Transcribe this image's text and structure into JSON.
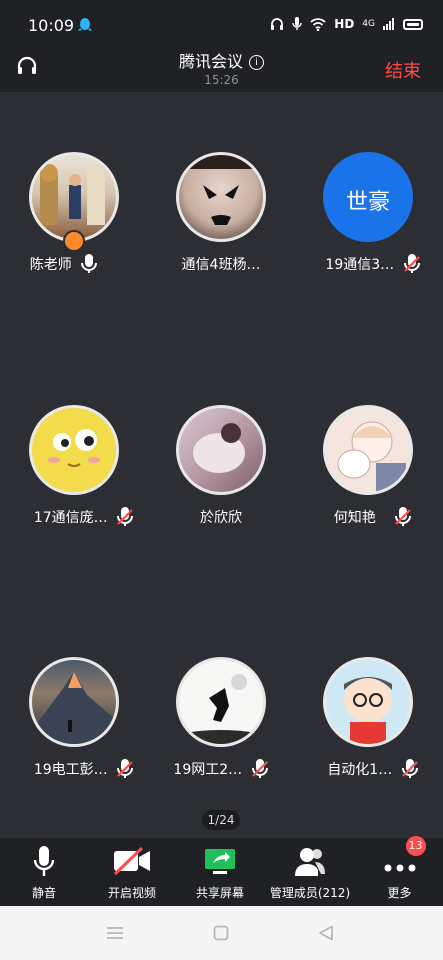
{
  "status_bar": {
    "time": "10:09",
    "indicators": [
      "headset-icon",
      "mic-icon",
      "wifi-icon",
      "HD",
      "4G",
      "signal-icon",
      "battery-icon"
    ],
    "hd_label": "HD",
    "network_label": "4G"
  },
  "header": {
    "title": "腾讯会议",
    "duration": "15:26",
    "end_label": "结束",
    "colors": {
      "end": "#ff4a4a"
    }
  },
  "participants": [
    {
      "name": "陈老师",
      "mic": "on",
      "is_host": true
    },
    {
      "name": "通信4班杨…",
      "mic": "none"
    },
    {
      "name": "19通信3…",
      "mic": "muted",
      "avatar_text": "世豪",
      "avatar_color": "#1a73e8"
    },
    {
      "name": "17通信庞…",
      "mic": "muted"
    },
    {
      "name": "於欣欣",
      "mic": "none"
    },
    {
      "name": "何知艳",
      "mic": "muted"
    },
    {
      "name": "19电工彭…",
      "mic": "muted"
    },
    {
      "name": "19网工2…",
      "mic": "muted"
    },
    {
      "name": "自动化1…",
      "mic": "muted"
    }
  ],
  "pager": "1/24",
  "toolbar": {
    "mute": "静音",
    "video": "开启视频",
    "share": "共享屏幕",
    "members": "管理成员(212)",
    "more": "更多",
    "more_badge": "13"
  },
  "nav": [
    "menu-icon",
    "home-icon",
    "back-icon"
  ]
}
